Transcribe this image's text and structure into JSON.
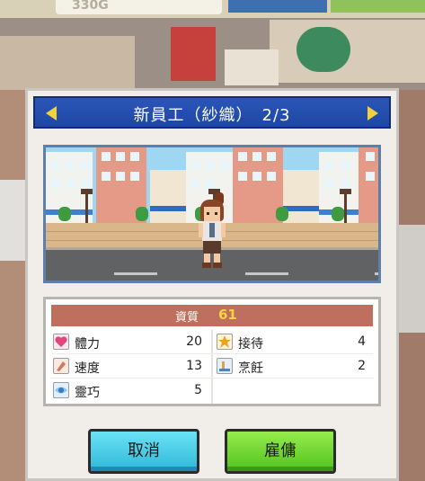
{
  "hud": {
    "money": "330G"
  },
  "dialog": {
    "title": "新員工（紗織）　2/3",
    "quality_label": "資質",
    "quality_value": "61",
    "stats_left": [
      {
        "icon": "heart-icon",
        "name": "體力",
        "value": "20",
        "color": "#e0467a"
      },
      {
        "icon": "speed-icon",
        "name": "速度",
        "value": "13",
        "color": "#d07a5a"
      },
      {
        "icon": "eye-icon",
        "name": "靈巧",
        "value": "5",
        "color": "#2f7cc7"
      }
    ],
    "stats_right": [
      {
        "icon": "star-icon",
        "name": "接待",
        "value": "4",
        "color": "#f0a020"
      },
      {
        "icon": "cooking-icon",
        "name": "烹飪",
        "value": "2",
        "color": "#5a7fb8"
      }
    ],
    "cancel_label": "取消",
    "hire_label": "雇傭"
  },
  "colors": {
    "title_bar": "#2a55b8",
    "quality_bar": "#bf6f5e",
    "cancel_button": "#2fb8d9",
    "hire_button": "#51c21e"
  }
}
